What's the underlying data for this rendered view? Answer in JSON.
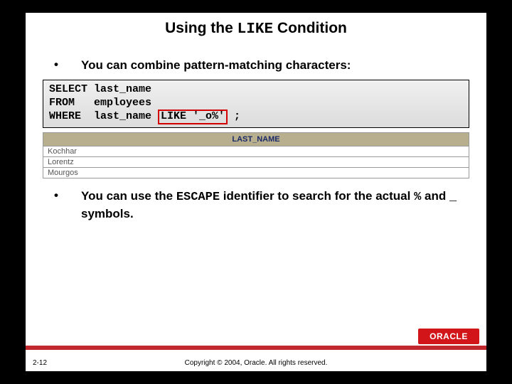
{
  "title": {
    "pre": "Using the ",
    "keyword": "LIKE",
    "post": " Condition"
  },
  "bullet1": "You can combine pattern-matching characters:",
  "code": {
    "line1": "SELECT last_name",
    "line2": "FROM   employees",
    "line3a": "WHERE  last_name ",
    "line3_hl": "LIKE '_o%'",
    "line3b": " ;"
  },
  "results": {
    "header": "LAST_NAME",
    "rows": [
      "Kochhar",
      "Lorentz",
      "Mourgos"
    ]
  },
  "bullet2": {
    "a": "You can use the ",
    "b": "ESCAPE",
    "c": " identifier to search for the actual ",
    "d": "%",
    "e": " and ",
    "f": "_",
    "g": " symbols."
  },
  "footer": {
    "slide": "2-12",
    "copyright": "Copyright © 2004, Oracle. All rights reserved."
  },
  "logo": "ORACLE"
}
